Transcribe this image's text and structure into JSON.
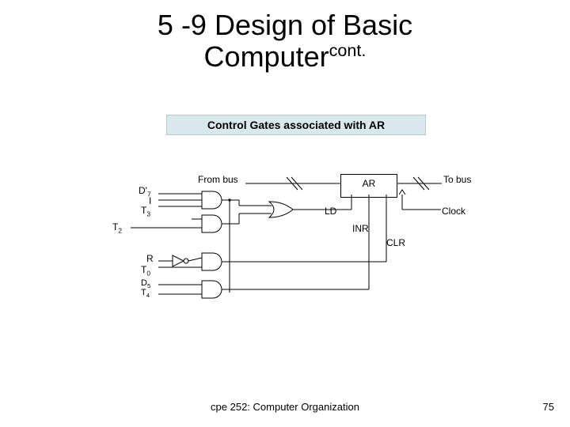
{
  "title": {
    "line1": "5 -9 Design of Basic",
    "line2_base": "Computer",
    "line2_sup": "cont."
  },
  "subtitle": "Control Gates associated with AR",
  "diagram": {
    "from_bus": "From bus",
    "to_bus": "To bus",
    "ar": "AR",
    "ld": "LD",
    "inr": "INR",
    "clr": "CLR",
    "clock": "Clock",
    "inputs": {
      "d7": "D'",
      "d7_sub": "7",
      "i": "I",
      "t3": "T",
      "t3_sub": "3",
      "t2": "T",
      "t2_sub": "2",
      "r": "R",
      "t0": "T",
      "t0_sub": "0",
      "d5": "D",
      "d5_sub": "5",
      "t4": "T",
      "t4_sub": "4"
    }
  },
  "footer": "cpe 252: Computer Organization",
  "page": "75"
}
